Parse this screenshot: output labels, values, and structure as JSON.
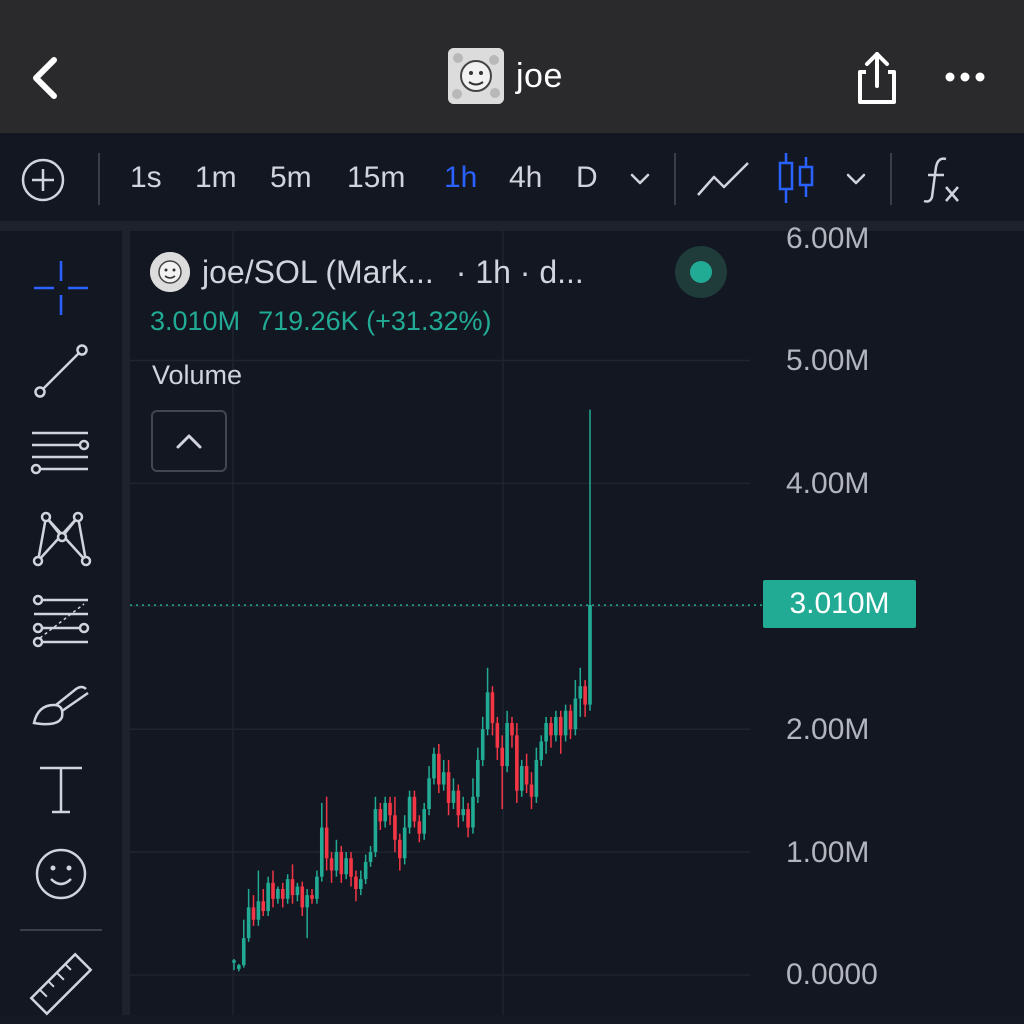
{
  "header": {
    "title": "joe",
    "back_icon": "chevron-left-icon",
    "share_icon": "share-icon",
    "more_icon": "more-horizontal-icon"
  },
  "toolbar": {
    "intervals": [
      "1s",
      "1m",
      "5m",
      "15m",
      "1h",
      "4h",
      "D"
    ],
    "active_interval": "1h",
    "icons": [
      "add-icon",
      "chevron-down-icon",
      "line-chart-icon",
      "candles-icon",
      "chevron-down-icon",
      "function-icon"
    ],
    "active_color": "#2962ff"
  },
  "sidebar": {
    "tools": [
      "crosshair-icon",
      "trend-line-icon",
      "horizontal-lines-icon",
      "pattern-icon",
      "fib-icon",
      "brush-icon",
      "text-icon",
      "emoji-icon",
      "ruler-icon"
    ]
  },
  "legend": {
    "symbol": "joe/SOL (Mark...",
    "meta": "· 1h · d...",
    "price": "3.010M",
    "change": "719.26K (+31.32%)",
    "volume_label": "Volume"
  },
  "chart_data": {
    "type": "candlestick",
    "y_ticks": [
      "6.00M",
      "5.00M",
      "4.00M",
      "2.00M",
      "1.00M",
      "0.0000"
    ],
    "last_price_label": "3.010M",
    "last_price": 3010000,
    "ylim": [
      0,
      6000000
    ],
    "up_color": "#22ab94",
    "down_color": "#f23645",
    "candles": [
      [
        0.1,
        0.12,
        0.05,
        0.04,
        0.13
      ],
      [
        0.05,
        0.08,
        0.04,
        0.03,
        0.09
      ],
      [
        0.08,
        0.3,
        0.07,
        0.06,
        0.45
      ],
      [
        0.3,
        0.55,
        0.28,
        0.27,
        0.7
      ],
      [
        0.55,
        0.45,
        0.42,
        0.4,
        0.65
      ],
      [
        0.45,
        0.6,
        0.43,
        0.4,
        0.85
      ],
      [
        0.6,
        0.52,
        0.5,
        0.48,
        0.7
      ],
      [
        0.52,
        0.75,
        0.5,
        0.48,
        0.8
      ],
      [
        0.75,
        0.62,
        0.58,
        0.55,
        0.85
      ],
      [
        0.62,
        0.7,
        0.6,
        0.58,
        0.72
      ],
      [
        0.7,
        0.62,
        0.58,
        0.55,
        0.75
      ],
      [
        0.62,
        0.78,
        0.6,
        0.58,
        0.82
      ],
      [
        0.78,
        0.65,
        0.6,
        0.58,
        0.9
      ],
      [
        0.65,
        0.72,
        0.62,
        0.6,
        0.75
      ],
      [
        0.72,
        0.55,
        0.5,
        0.48,
        0.76
      ],
      [
        0.55,
        0.65,
        0.5,
        0.3,
        0.7
      ],
      [
        0.65,
        0.62,
        0.6,
        0.58,
        0.7
      ],
      [
        0.62,
        0.8,
        0.6,
        0.58,
        0.85
      ],
      [
        0.8,
        1.2,
        0.78,
        0.76,
        1.4
      ],
      [
        1.2,
        0.95,
        0.9,
        0.85,
        1.45
      ],
      [
        0.95,
        0.85,
        0.8,
        0.75,
        1.0
      ],
      [
        0.85,
        1.0,
        0.82,
        0.8,
        1.1
      ],
      [
        1.0,
        0.82,
        0.78,
        0.75,
        1.05
      ],
      [
        0.82,
        0.95,
        0.8,
        0.78,
        1.0
      ],
      [
        0.95,
        0.8,
        0.76,
        0.72,
        1.0
      ],
      [
        0.8,
        0.7,
        0.68,
        0.6,
        0.85
      ],
      [
        0.7,
        0.78,
        0.68,
        0.65,
        0.85
      ],
      [
        0.78,
        0.92,
        0.76,
        0.74,
        0.98
      ],
      [
        0.92,
        1.0,
        0.9,
        0.88,
        1.05
      ],
      [
        1.0,
        1.35,
        0.98,
        0.96,
        1.45
      ],
      [
        1.35,
        1.25,
        1.2,
        1.18,
        1.4
      ],
      [
        1.25,
        1.4,
        1.22,
        1.2,
        1.45
      ],
      [
        1.4,
        1.3,
        1.25,
        1.22,
        1.45
      ],
      [
        1.3,
        1.1,
        1.05,
        1.0,
        1.45
      ],
      [
        1.1,
        0.95,
        0.9,
        0.85,
        1.15
      ],
      [
        0.95,
        1.2,
        0.92,
        0.9,
        1.3
      ],
      [
        1.2,
        1.45,
        1.18,
        1.15,
        1.5
      ],
      [
        1.45,
        1.25,
        1.22,
        1.2,
        1.5
      ],
      [
        1.25,
        1.15,
        1.1,
        1.08,
        1.3
      ],
      [
        1.15,
        1.35,
        1.12,
        1.1,
        1.4
      ],
      [
        1.35,
        1.6,
        1.32,
        1.3,
        1.7
      ],
      [
        1.6,
        1.8,
        1.58,
        1.55,
        1.85
      ],
      [
        1.8,
        1.55,
        1.5,
        1.48,
        1.88
      ],
      [
        1.55,
        1.65,
        1.52,
        1.5,
        1.75
      ],
      [
        1.65,
        1.4,
        1.35,
        1.3,
        1.75
      ],
      [
        1.4,
        1.5,
        1.38,
        1.35,
        1.6
      ],
      [
        1.5,
        1.3,
        1.28,
        1.2,
        1.55
      ],
      [
        1.3,
        1.35,
        1.28,
        1.25,
        1.45
      ],
      [
        1.35,
        1.2,
        1.15,
        1.12,
        1.4
      ],
      [
        1.2,
        1.45,
        1.18,
        1.15,
        1.6
      ],
      [
        1.45,
        1.75,
        1.42,
        1.4,
        1.85
      ],
      [
        1.75,
        2.0,
        1.72,
        1.7,
        2.1
      ],
      [
        2.0,
        2.3,
        1.98,
        1.95,
        2.5
      ],
      [
        2.3,
        2.05,
        2.0,
        1.95,
        2.35
      ],
      [
        2.05,
        1.85,
        1.8,
        1.75,
        2.1
      ],
      [
        1.85,
        1.7,
        1.65,
        1.35,
        1.95
      ],
      [
        1.7,
        2.05,
        1.68,
        1.65,
        2.15
      ],
      [
        2.05,
        1.95,
        1.9,
        1.85,
        2.1
      ],
      [
        1.95,
        1.5,
        1.45,
        1.4,
        2.05
      ],
      [
        1.5,
        1.7,
        1.48,
        1.45,
        1.75
      ],
      [
        1.7,
        1.55,
        1.5,
        1.48,
        1.8
      ],
      [
        1.55,
        1.45,
        1.4,
        1.35,
        1.65
      ],
      [
        1.45,
        1.75,
        1.42,
        1.4,
        1.85
      ],
      [
        1.75,
        1.9,
        1.72,
        1.7,
        1.95
      ],
      [
        1.9,
        2.05,
        1.88,
        1.8,
        2.1
      ],
      [
        2.05,
        1.95,
        1.9,
        1.85,
        2.1
      ],
      [
        1.95,
        2.1,
        1.92,
        1.9,
        2.15
      ],
      [
        2.1,
        1.95,
        1.9,
        1.8,
        2.15
      ],
      [
        1.95,
        2.15,
        1.92,
        1.9,
        2.2
      ],
      [
        2.15,
        2.0,
        1.95,
        1.92,
        2.2
      ],
      [
        2.0,
        2.25,
        1.98,
        1.95,
        2.4
      ],
      [
        2.25,
        2.35,
        2.22,
        2.1,
        2.5
      ],
      [
        2.35,
        2.2,
        2.15,
        2.1,
        2.4
      ],
      [
        2.2,
        3.01,
        2.18,
        2.15,
        4.6
      ]
    ]
  }
}
